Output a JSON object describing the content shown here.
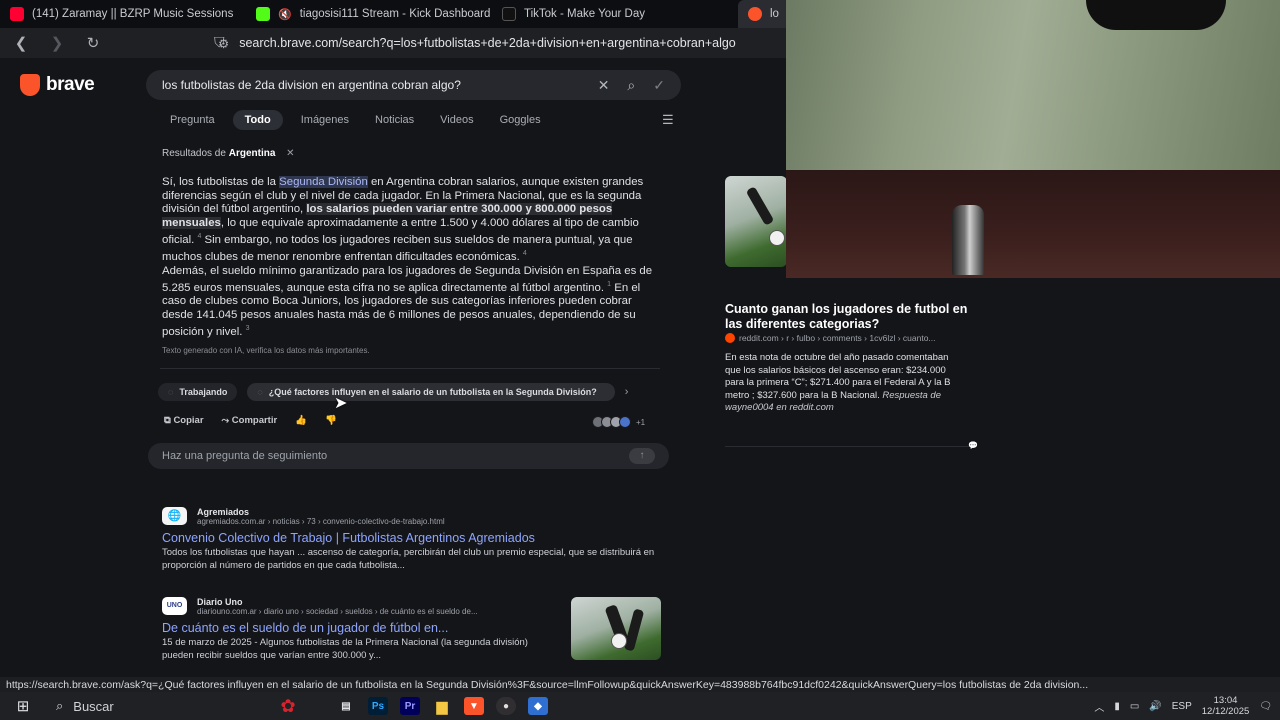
{
  "tabs": [
    {
      "label": "(141) Zaramay || BZRP Music Sessions",
      "color": "#ff0033",
      "icon": "youtube-icon"
    },
    {
      "label": "tiagosisi111 Stream - Kick Dashboard",
      "color": "#53fc18",
      "icon": "kick-icon"
    },
    {
      "label": "TikTok - Make Your Day",
      "color": "#111111",
      "icon": "tiktok-icon"
    },
    {
      "label": "lo",
      "color": "#fb542b",
      "icon": "brave-icon"
    }
  ],
  "address": {
    "url": "search.brave.com/search?q=los+futbolistas+de+2da+division+en+argentina+cobran+algo"
  },
  "brand": {
    "name": "brave"
  },
  "search": {
    "query": "los futbolistas de 2da division en argentina cobran algo?"
  },
  "filters": [
    "Pregunta",
    "Todo",
    "Imágenes",
    "Noticias",
    "Videos",
    "Goggles"
  ],
  "active_filter": "Todo",
  "region": {
    "prefix": "Resultados de",
    "country": "Argentina"
  },
  "answer": {
    "p1_a": "Sí, los futbolistas de la ",
    "p1_hl": "Segunda División",
    "p1_b": " en Argentina cobran salarios, aunque existen grandes diferencias según el club y el nivel de cada jugador. En la Primera Nacional, que es la segunda división del fútbol argentino, ",
    "p1_bold": "los salarios pueden variar entre 300.000 y 800.000 pesos mensuales",
    "p1_c": ", lo que equivale aproximadamente a entre 1.500 y 4.000 dólares al tipo de cambio oficial.",
    "ref4": "4",
    "p1_d": " Sin embargo, no todos los jugadores reciben sus sueldos de manera puntual, ya que muchos clubes de menor renombre enfrentan dificultades económicas.",
    "p2_a": "Además, el sueldo mínimo garantizado para los jugadores de Segunda División en España es de 5.285 euros mensuales, aunque esta cifra no se aplica directamente al fútbol argentino.",
    "ref1": "1",
    "p2_b": " En el caso de clubes como Boca Juniors, los jugadores de sus categorías inferiores pueden cobrar desde 141.045 pesos anuales hasta más de 6 millones de pesos anuales, dependiendo de su posición y nivel.",
    "ref3": "3",
    "disclaimer": "Texto generado con IA, verifica los datos más importantes."
  },
  "chips": {
    "working": "Trabajando",
    "question": "¿Qué factores influyen en el salario de un futbolista en la Segunda División?"
  },
  "actions": {
    "copy": "Copiar",
    "share": "Compartir",
    "more_sources": "+1"
  },
  "followup": {
    "placeholder": "Haz una pregunta de seguimiento"
  },
  "results": [
    {
      "source": "Agremiados",
      "url": "agremiados.com.ar › noticias › 73 › convenio-colectivo-de-trabajo.html",
      "title": "Convenio Colectivo de Trabajo | Futbolistas Argentinos Agremiados",
      "desc": "Todos los futbolistas que hayan ... ascenso de categoría, percibirán del club un premio especial, que se distribuirá en proporción al número de partidos en que cada futbolista..."
    },
    {
      "source": "Diario Uno",
      "icon_text": "UNO",
      "url": "diariouno.com.ar › diario uno › sociedad › sueldos › de cuánto es el sueldo de...",
      "title": "De cuánto es el sueldo de un jugador de fútbol en...",
      "desc": "15 de marzo de 2025 - Algunos futbolistas de la Primera Nacional (la segunda división) pueden recibir sueldos que varían entre 300.000 y..."
    }
  ],
  "side": {
    "title": "Cuanto ganan los jugadores de futbol en las diferentes categorias?",
    "src": "reddit.com › r › fulbo › comments › 1cv6lzl › cuanto...",
    "desc": "En esta nota de octubre del año pasado comentaban que los salarios básicos del ascenso eran: $234.000 para la primera “C”; $271.400 para el Federal A y la B metro ; $327.600 para la B Nacional.",
    "desc_italic": "Respuesta de wayne0004 en reddit.com"
  },
  "status_url": "https://search.brave.com/ask?q=¿Qué factores influyen en el salario de un futbolista en la Segunda División%3F&source=llmFollowup&quickAnswerKey=483988b764fbc91dcf0242&quickAnswerQuery=los futbolistas de 2da division...",
  "taskbar": {
    "search_label": "Buscar",
    "lang": "ESP",
    "time": "13:04",
    "date": "12/12/2025",
    "apps": [
      {
        "name": "task-view",
        "label": "▤",
        "bg": "transparent",
        "fg": "#dfe1e5"
      },
      {
        "name": "photoshop",
        "label": "Ps",
        "bg": "#001e36",
        "fg": "#31a8ff"
      },
      {
        "name": "premiere",
        "label": "Pr",
        "bg": "#00005b",
        "fg": "#9999ff"
      },
      {
        "name": "file-explorer",
        "label": "▆",
        "bg": "transparent",
        "fg": "#f3c744"
      },
      {
        "name": "brave",
        "label": "▼",
        "bg": "#fb542b",
        "fg": "#ffffff"
      },
      {
        "name": "obs",
        "label": "●",
        "bg": "#302e31",
        "fg": "#e0e0e0"
      },
      {
        "name": "app-blue",
        "label": "◆",
        "bg": "#2f6fd1",
        "fg": "#ffffff"
      }
    ]
  }
}
